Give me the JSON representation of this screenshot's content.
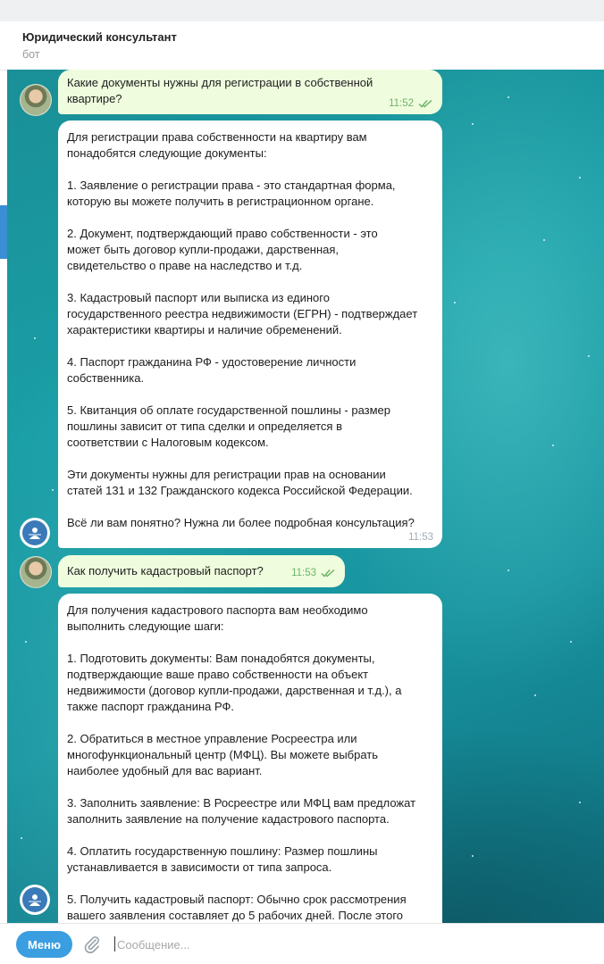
{
  "header": {
    "title": "Юридический консультант",
    "subtitle": "бот"
  },
  "messages": [
    {
      "sender": "user",
      "text": "Какие документы нужны для регистрации в собственной\nквартире?",
      "time": "11:52"
    },
    {
      "sender": "bot",
      "text": "Для регистрации права собственности на квартиру вам\nпонадобятся следующие документы:\n\n1. Заявление о регистрации права - это стандартная форма,\nкоторую вы можете получить в регистрационном органе.\n\n2. Документ, подтверждающий право собственности - это\nможет быть договор купли-продажи, дарственная,\nсвидетельство о праве на наследство и т.д.\n\n3. Кадастровый паспорт или выписка из единого\nгосударственного реестра недвижимости (ЕГРН) - подтверждает\nхарактеристики квартиры и наличие обременений.\n\n4. Паспорт гражданина РФ - удостоверение личности\nсобственника.\n\n5. Квитанция об оплате государственной пошлины - размер\nпошлины зависит от типа сделки и определяется в\nсоответствии с Налоговым кодексом.\n\nЭти документы нужны для регистрации прав на основании\nстатей 131 и 132 Гражданского кодекса Российской Федерации.\n\nВсё ли вам понятно? Нужна ли более подробная консультация?",
      "time": "11:53"
    },
    {
      "sender": "user",
      "text": "Как получить кадастровый паспорт?",
      "time": "11:53"
    },
    {
      "sender": "bot",
      "text": "Для получения кадастрового паспорта вам необходимо\nвыполнить следующие шаги:\n\n1. Подготовить документы: Вам понадобятся документы,\nподтверждающие ваше право собственности на объект\nнедвижимости (договор купли-продажи, дарственная и т.д.), а\nтакже паспорт гражданина РФ.\n\n2. Обратиться в местное управление Росреестра или\nмногофункциональный центр (МФЦ). Вы можете выбрать\nнаиболее удобный для вас вариант.\n\n3. Заполнить заявление: В Росреестре или МФЦ вам предложат\nзаполнить заявление на получение кадастрового паспорта.\n\n4. Оплатить государственную пошлину: Размер пошлины\nустанавливается в зависимости от типа запроса.\n\n5. Получить кадастровый паспорт: Обычно срок рассмотрения\nвашего заявления составляет до 5 рабочих дней. После этого"
    }
  ],
  "composer": {
    "menu_label": "Меню",
    "placeholder": "Сообщение..."
  },
  "colors": {
    "accent": "#3a9ee0",
    "outgoing_bubble": "#effdde",
    "incoming_bubble": "#ffffff",
    "read_check": "#6fb36b"
  },
  "icons": [
    "user-avatar-icon",
    "bot-avatar-icon",
    "double-check-icon",
    "paperclip-icon"
  ]
}
